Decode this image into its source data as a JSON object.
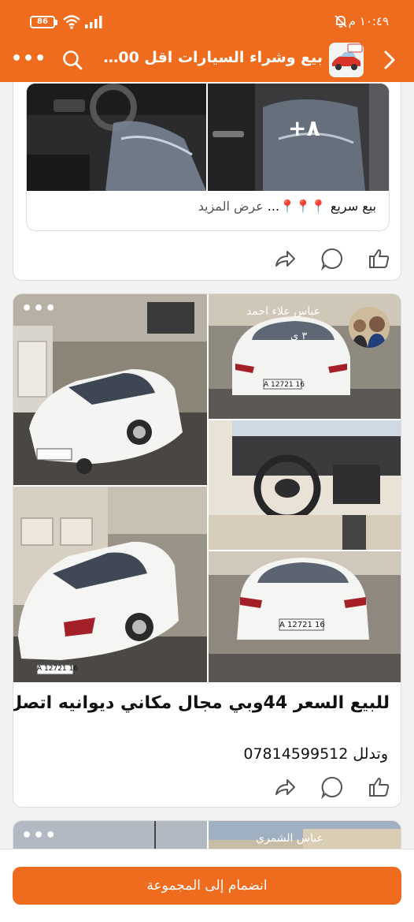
{
  "status_bar": {
    "battery": "86",
    "time": "١٠:٤٩ م"
  },
  "app_bar": {
    "title": "بيع وشراء السيارات اقل 100 ور..."
  },
  "post1": {
    "extra_photos": "+٨",
    "preview_text": "بيع سريع 📍📍📍... ",
    "see_more": "عرض المزيد"
  },
  "post2": {
    "watermark_top": "عباس علاء احمد",
    "watermark_sub": "٣ ي",
    "plate_1": "16 A 12721",
    "plate_2": "16 A 12721",
    "plate_3": "16 A 12721",
    "text_line1": "للبيع السعر 44وبي مجال مكاني ديوانيه اتصل",
    "text_line2": "وتدلل 07814599512"
  },
  "post3": {
    "watermark": "عباس الشمري"
  },
  "bottom": {
    "join_label": "انضمام إلى المجموعة"
  },
  "colors": {
    "accent": "#ef6c1e",
    "card_bg": "#ffffff",
    "page_bg": "#f2f2f2"
  },
  "icons": [
    "battery-icon",
    "wifi-icon",
    "signal-icon",
    "mute-icon",
    "more-icon",
    "search-icon",
    "group-avatar",
    "back-arrow-icon",
    "share-icon",
    "comment-icon",
    "like-icon"
  ]
}
